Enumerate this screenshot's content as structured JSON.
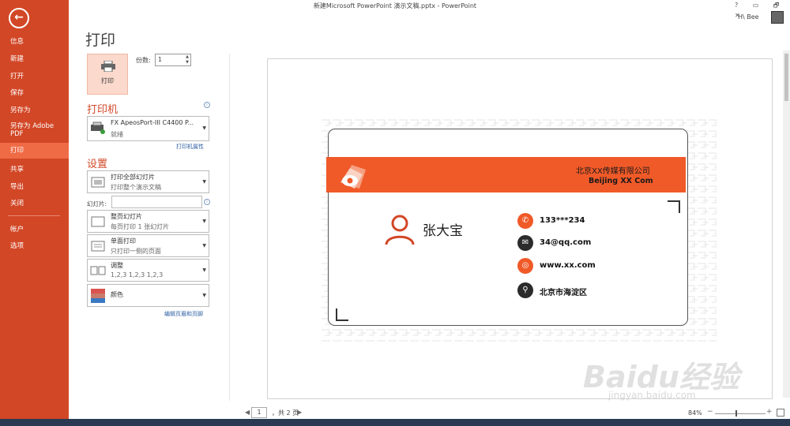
{
  "window": {
    "title": "新建Microsoft PowerPoint 演示文稿.pptx - PowerPoint",
    "controls": "? ▭ 🗗 ✕",
    "user": "H\\ Bee"
  },
  "nav": {
    "back": "←",
    "items": [
      {
        "label": "信息"
      },
      {
        "label": "新建"
      },
      {
        "label": "打开"
      },
      {
        "label": "保存"
      },
      {
        "label": "另存为"
      },
      {
        "label": "另存为 Adobe PDF"
      },
      {
        "label": "打印"
      },
      {
        "label": "共享"
      },
      {
        "label": "导出"
      },
      {
        "label": "关闭"
      },
      {
        "label": "帐户"
      },
      {
        "label": "选项"
      }
    ],
    "active_color": "#ef6b46",
    "bg_color": "#d24726"
  },
  "print": {
    "heading": "打印",
    "button_label": "打印",
    "copies_label": "份数:",
    "copies_value": "1"
  },
  "printer": {
    "heading": "打印机",
    "name": "FX ApeosPort-III C4400 P...",
    "status": "就绪",
    "properties_link": "打印机属性"
  },
  "settings": {
    "heading": "设置",
    "range_main": "打印全部幻灯片",
    "range_sub": "打印整个演示文稿",
    "slides_label": "幻灯片:",
    "slides_value": "",
    "layout_main": "整页幻灯片",
    "layout_sub": "每页打印 1 张幻灯片",
    "sides_main": "单面打印",
    "sides_sub": "只打印一侧的页面",
    "collate_main": "调整",
    "collate_sub": "1,2,3    1,2,3    1,2,3",
    "color_main": "颜色",
    "header_footer_link": "编辑页眉和页脚"
  },
  "preview": {
    "company_cn": "北京XX传媒有限公司",
    "company_en": "Beijing XX Com",
    "name": "张大宝",
    "contacts": [
      {
        "icon": "phone-icon",
        "text": "133***234",
        "color": "#f05a28"
      },
      {
        "icon": "mail-icon",
        "text": "34@qq.com",
        "color": "#2b2b2b"
      },
      {
        "icon": "globe-icon",
        "text": "www.xx.com",
        "color": "#f05a28"
      },
      {
        "icon": "location-icon",
        "text": "北京市海淀区",
        "color": "#2b2b2b"
      }
    ],
    "accent": "#f05a28"
  },
  "status": {
    "page_value": "1",
    "page_total": "，共 2 页",
    "zoom": "84%"
  },
  "watermark": {
    "text": "Baidu经验",
    "url": "jingyan.baidu.com"
  }
}
